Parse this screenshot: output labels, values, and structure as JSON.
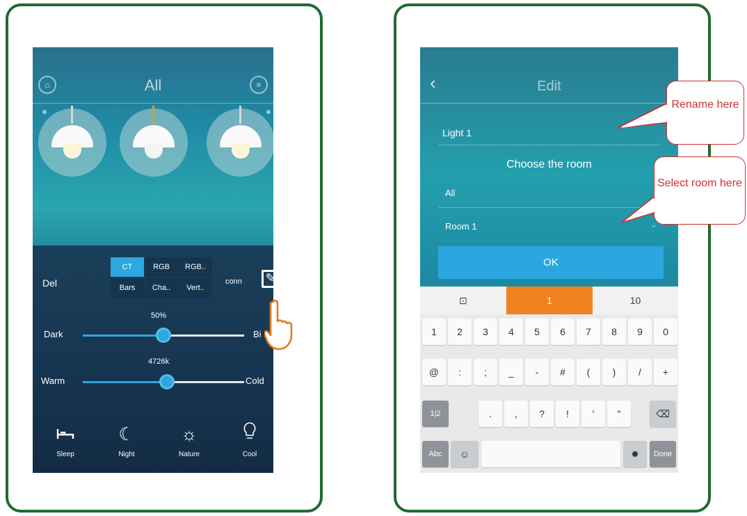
{
  "left_phone": {
    "title": "All",
    "lamps": [
      "lamp-1",
      "lamp-2",
      "lamp-3"
    ],
    "delete_label": "Del",
    "modes": [
      {
        "label": "CT",
        "active": true
      },
      {
        "label": "RGB",
        "active": false
      },
      {
        "label": "RGB..",
        "active": false
      },
      {
        "label": "Bars",
        "active": false
      },
      {
        "label": "Cha..",
        "active": false
      },
      {
        "label": "Vert..",
        "active": false
      }
    ],
    "conn_label": "conn",
    "brightness": {
      "value_text": "50%",
      "value": 0.5,
      "min_label": "Dark",
      "max_label": "Bi"
    },
    "color_temp": {
      "value_text": "4726k",
      "value": 0.52,
      "min_label": "Warm",
      "max_label": "Cold"
    },
    "scenes": [
      {
        "label": "Sleep",
        "icon": "bed-icon"
      },
      {
        "label": "Night",
        "icon": "moon-icon"
      },
      {
        "label": "Nature",
        "icon": "sun-icon"
      },
      {
        "label": "Cool",
        "icon": "bulb-icon"
      }
    ]
  },
  "right_phone": {
    "title": "Edit",
    "name_value": "Light 1",
    "choose_label": "Choose the room",
    "rooms": [
      "All",
      "Room 1"
    ],
    "ok_label": "OK",
    "keyboard": {
      "suggestions": [
        "⊡",
        "1",
        "10"
      ],
      "row1": [
        "1",
        "2",
        "3",
        "4",
        "5",
        "6",
        "7",
        "8",
        "9",
        "0"
      ],
      "row2": [
        "@",
        ":",
        ";",
        "_",
        "-",
        "#",
        "(",
        ")",
        "/",
        "+"
      ],
      "row3": [
        "1|2",
        ".",
        ",",
        "?",
        "!",
        "'",
        "\""
      ],
      "row4_left": "Abc",
      "done_label": "Done"
    }
  },
  "callouts": {
    "rename": "Rename here",
    "room": "Select room here"
  },
  "colors": {
    "frame": "#1e6b32",
    "accent": "#2aa8df",
    "suggestion_active": "#f08220",
    "callout": "#d32f2f"
  }
}
